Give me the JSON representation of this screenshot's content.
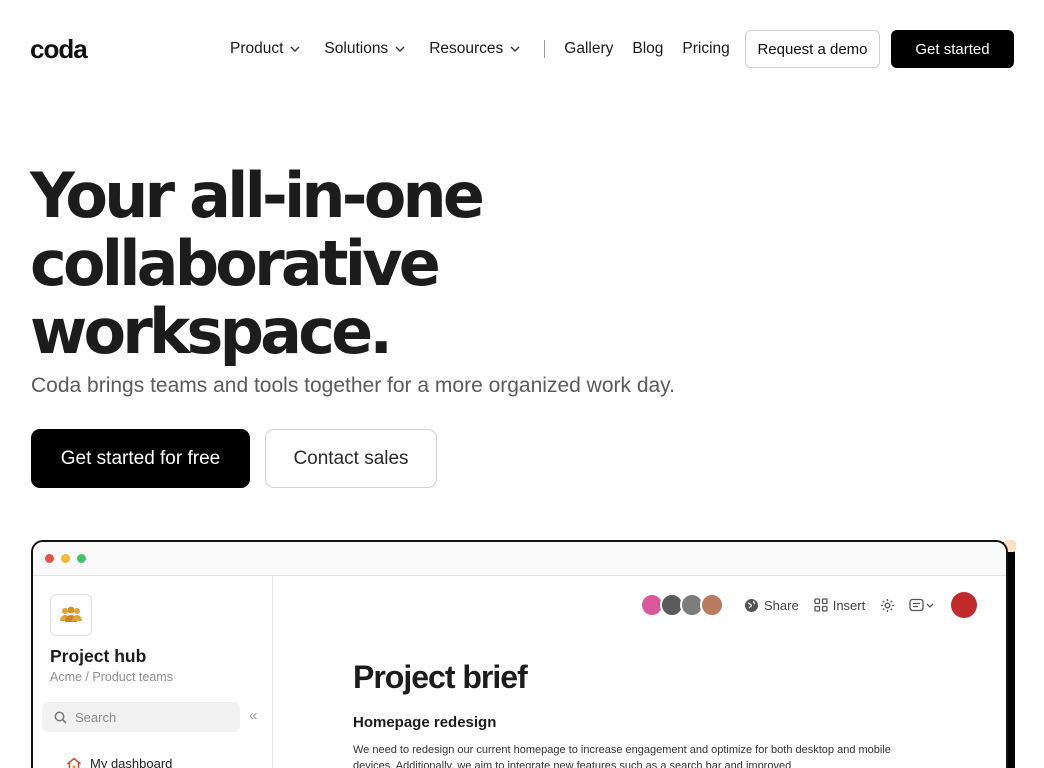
{
  "nav": {
    "logo": "coda",
    "links": [
      {
        "label": "Product",
        "has_dropdown": true
      },
      {
        "label": "Solutions",
        "has_dropdown": true
      },
      {
        "label": "Resources",
        "has_dropdown": true
      }
    ],
    "plain_links": [
      "Gallery",
      "Blog",
      "Pricing"
    ],
    "request_demo": "Request a demo",
    "get_started": "Get started"
  },
  "hero": {
    "title_lines": [
      "Your all-in-one",
      "collaborative",
      "workspace."
    ],
    "subtitle": "Coda brings teams and tools together for a more organized work day.",
    "cta_primary": "Get started for free",
    "cta_secondary": "Contact sales"
  },
  "app": {
    "window_dots": [
      "#e5534b",
      "#f1b93a",
      "#43c46a"
    ],
    "sidebar": {
      "hub_icon": "team-icon",
      "title": "Project hub",
      "breadcrumb": "Acme / Product teams",
      "search_placeholder": "Search",
      "collapse_glyph": "«",
      "items": [
        {
          "label": "My dashboard",
          "icon": "home-icon"
        }
      ]
    },
    "toolbar": {
      "avatar_colors": [
        "#d85a9a",
        "#5a5a5a",
        "#7c7c7c",
        "#b97a62"
      ],
      "share": "Share",
      "insert": "Insert",
      "user_avatar_color": "#c22b2b"
    },
    "doc": {
      "title": "Project brief",
      "heading": "Homepage redesign",
      "paragraph": "We need to redesign our current homepage to increase engagement and optimize for both desktop and mobile devices. Additionally, we aim to integrate new features such as a search bar and improved"
    }
  }
}
